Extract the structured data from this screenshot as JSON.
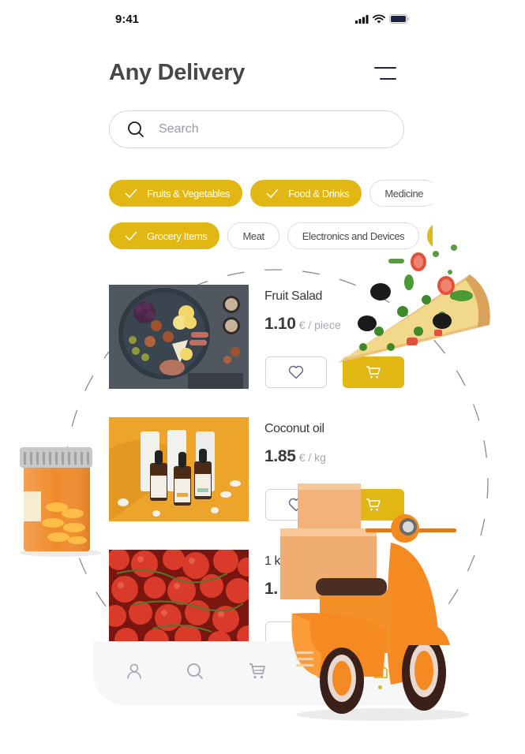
{
  "status_bar": {
    "time": "9:41",
    "icons": [
      "signal-icon",
      "wifi-icon",
      "battery-icon"
    ]
  },
  "header": {
    "title": "Any Delivery",
    "menu_icon": "menu-icon"
  },
  "search": {
    "placeholder": "Search",
    "value": "",
    "icon": "search-icon"
  },
  "categories": {
    "row1": [
      {
        "label": "Fruits & Vegetables",
        "selected": true
      },
      {
        "label": "Food & Drinks",
        "selected": true
      },
      {
        "label": "Medicine",
        "selected": false
      }
    ],
    "row2": [
      {
        "label": "Grocery Items",
        "selected": true
      },
      {
        "label": "Meat",
        "selected": false
      },
      {
        "label": "Electronics and Devices",
        "selected": false
      }
    ]
  },
  "products": [
    {
      "name": "Fruit Salad",
      "price": "1.10",
      "unit": "€ / piece",
      "image": "fruit-platter-photo"
    },
    {
      "name": "Coconut oil",
      "price": "1.85",
      "unit": "€ / kg",
      "image": "oil-bottles-photo"
    },
    {
      "name": "1 k",
      "price": "1.",
      "unit": "",
      "image": "tomatoes-photo"
    }
  ],
  "bottom_nav": {
    "items": [
      {
        "icon": "profile-icon",
        "active": false
      },
      {
        "icon": "search-icon",
        "active": false
      },
      {
        "icon": "cart-icon",
        "active": false
      },
      {
        "icon": "heart-icon",
        "active": false
      },
      {
        "icon": "home-icon",
        "active": true
      }
    ]
  },
  "colors": {
    "accent": "#e2b714",
    "title": "#474747",
    "nav_icon": "#a4a7ae",
    "nav_bg": "#f6f7f8",
    "placeholder": "#9b97ab"
  },
  "decorations": [
    "pizza-slice-illustration",
    "pill-bottle-illustration",
    "delivery-scooter-illustration"
  ]
}
